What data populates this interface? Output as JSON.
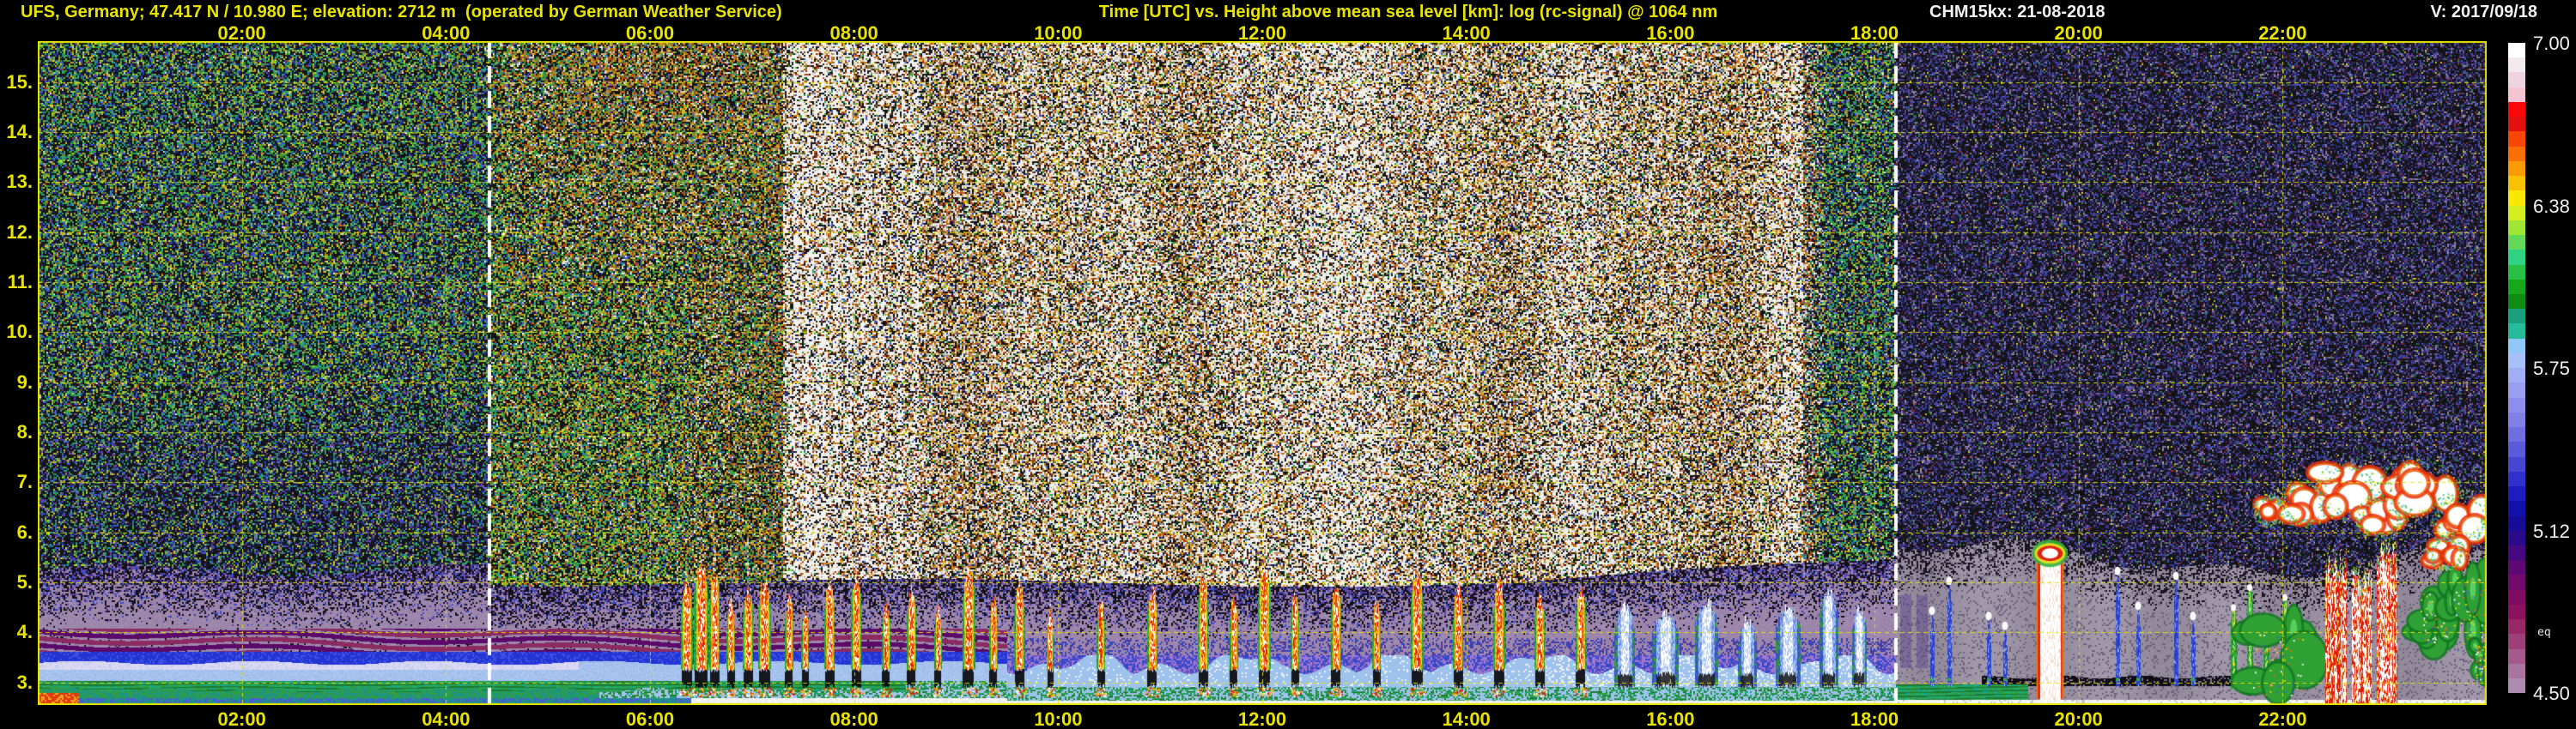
{
  "header": {
    "left": "UFS, Germany; 47.417 N / 10.980 E; elevation: 2712 m  (operated by German Weather Service)",
    "center": "Time [UTC] vs. Height above mean sea level [km]: log (rc-signal) @ 1064 nm",
    "device_date": "CHM15kx: 21-08-2018",
    "version": "V: 2017/09/18"
  },
  "colors": {
    "background": "#000000",
    "axis_yellow": "#e8e400",
    "grid_yellow": "#e6e600",
    "text_white": "#f2f2f2",
    "sun_line": "#ffffff"
  },
  "axes": {
    "x_ticks": [
      "02:00",
      "04:00",
      "06:00",
      "08:00",
      "10:00",
      "12:00",
      "14:00",
      "16:00",
      "18:00",
      "20:00",
      "22:00"
    ],
    "y_ticks": [
      "15.",
      "14.",
      "13.",
      "12.",
      "11.",
      "10.",
      "9.",
      "8.",
      "7.",
      "6.",
      "5.",
      "4.",
      "3."
    ]
  },
  "colorbar": {
    "note": "eq",
    "labels": [
      {
        "text": "7.00",
        "v": 7.0
      },
      {
        "text": "6.38",
        "v": 6.375
      },
      {
        "text": "5.75",
        "v": 5.75
      },
      {
        "text": "5.12",
        "v": 5.125
      },
      {
        "text": "4.50",
        "v": 4.5
      }
    ],
    "palette": [
      "#ffffff",
      "#f2e8ee",
      "#eed4e0",
      "#f4c4d2",
      "#fa0808",
      "#e41010",
      "#fa4604",
      "#fa7004",
      "#fa9a04",
      "#fac204",
      "#fae804",
      "#d2ee1e",
      "#a0e634",
      "#62da58",
      "#30d284",
      "#28c045",
      "#16a81a",
      "#0f8c12",
      "#1ba07e",
      "#24bc9a",
      "#90c8f8",
      "#a8c0f8",
      "#a2aef4",
      "#9a9ef0",
      "#8e8eec",
      "#8080e6",
      "#6e6ee0",
      "#5a5ada",
      "#4646d2",
      "#3030cc",
      "#1c1cc0",
      "#1212aa",
      "#170c98",
      "#2c0a8c",
      "#460880",
      "#5e0876",
      "#720a6e",
      "#800c62",
      "#8c1260",
      "#962866",
      "#9e4078",
      "#a45a8c",
      "#aa74a0",
      "#ae8cb2"
    ]
  },
  "chart_data": {
    "type": "heatmap",
    "title": "Time [UTC] vs. Height above mean sea level [km]: log (rc-signal) @ 1064 nm",
    "station": "UFS, Germany; 47.417 N / 10.980 E; elevation: 2712 m",
    "instrument": "CHM15kx",
    "date": "21-08-2018",
    "x_hours_range": [
      0,
      24
    ],
    "y_km_range": [
      2.55,
      15.82
    ],
    "signal_range": [
      4.5,
      7.0
    ],
    "sun_lines_hours": [
      4.43,
      18.21
    ],
    "grid": {
      "x_step_hours": 2,
      "y_step_km": 1
    },
    "noise": {
      "night1_hi": {
        "black": 0.4,
        "colors": [
          [
            "#2fa23e",
            0.2
          ],
          [
            "#96c92e",
            0.13
          ],
          [
            "#c9c326",
            0.12
          ],
          [
            "#27a289",
            0.16
          ],
          [
            "#4157d6",
            0.17
          ],
          [
            "#232e8e",
            0.12
          ],
          [
            "#b8831e",
            0.05
          ],
          [
            "#b03a20",
            0.03
          ],
          [
            "#d8d8d8",
            0.02
          ]
        ]
      },
      "night1_lo": {
        "black": 0.5,
        "colors": [
          [
            "#3c50cc",
            0.22
          ],
          [
            "#232a80",
            0.16
          ],
          [
            "#279a86",
            0.14
          ],
          [
            "#2f9e40",
            0.14
          ],
          [
            "#6a3a9a",
            0.1
          ],
          [
            "#96c92e",
            0.08
          ],
          [
            "#c9c326",
            0.08
          ],
          [
            "#8a7a9e",
            0.08
          ]
        ]
      },
      "dawn": {
        "black": 0.36,
        "colors": [
          [
            "#2fa23e",
            0.22
          ],
          [
            "#96c92e",
            0.16
          ],
          [
            "#c9c326",
            0.16
          ],
          [
            "#c87a1e",
            0.12
          ],
          [
            "#27a289",
            0.12
          ],
          [
            "#4157d6",
            0.1
          ],
          [
            "#c04818",
            0.06
          ],
          [
            "#e8e4de",
            0.06
          ]
        ]
      },
      "day_orange": {
        "black": 0.33,
        "colors": [
          [
            "#c87a22",
            0.26
          ],
          [
            "#9a5a16",
            0.1
          ],
          [
            "#d8b81e",
            0.12
          ],
          [
            "#2fa23e",
            0.1
          ],
          [
            "#c03c16",
            0.08
          ],
          [
            "#e8e4de",
            0.14
          ],
          [
            "#4157d6",
            0.06
          ],
          [
            "#8a8a8a",
            0.06
          ],
          [
            "#27a289",
            0.04
          ],
          [
            "#96c92e",
            0.04
          ]
        ]
      },
      "day_bright": {
        "black": 0.27,
        "colors": [
          [
            "#f2efe8",
            0.3
          ],
          [
            "#cc7e20",
            0.22
          ],
          [
            "#b43c16",
            0.08
          ],
          [
            "#b8b2aa",
            0.1
          ],
          [
            "#d8c020",
            0.08
          ],
          [
            "#2fa23e",
            0.05
          ],
          [
            "#4157d6",
            0.05
          ],
          [
            "#9a5a16",
            0.06
          ],
          [
            "#e8e4de",
            0.06
          ]
        ]
      },
      "dusk": {
        "black": 0.4,
        "colors": [
          [
            "#2fa23e",
            0.22
          ],
          [
            "#27a289",
            0.16
          ],
          [
            "#96c92e",
            0.1
          ],
          [
            "#c9c326",
            0.1
          ],
          [
            "#4157d6",
            0.12
          ],
          [
            "#c87a1e",
            0.08
          ],
          [
            "#8a7a9e",
            0.06
          ],
          [
            "#e8e4de",
            0.04
          ],
          [
            "#232e8e",
            0.12
          ]
        ]
      },
      "night2": {
        "black": 0.52,
        "colors": [
          [
            "#3a3a92",
            0.22
          ],
          [
            "#5c4a9e",
            0.16
          ],
          [
            "#26285e",
            0.18
          ],
          [
            "#3c50b4",
            0.12
          ],
          [
            "#8a7aa0",
            0.14
          ],
          [
            "#44206a",
            0.1
          ],
          [
            "#2f7a3a",
            0.04
          ],
          [
            "#8a2a2a",
            0.02
          ],
          [
            "#c9c326",
            0.02
          ]
        ]
      }
    },
    "features": {
      "bright_stripes": [
        7.42,
        7.55,
        7.67,
        7.82,
        7.95,
        8.1,
        8.27,
        8.45,
        8.6
      ],
      "day_spikes": [
        [
          6.36,
          5.0,
          0.055
        ],
        [
          6.5,
          5.35,
          0.07
        ],
        [
          6.63,
          5.2,
          0.05
        ],
        [
          6.79,
          4.65,
          0.04
        ],
        [
          6.96,
          4.85,
          0.05
        ],
        [
          7.12,
          5.05,
          0.06
        ],
        [
          7.36,
          4.7,
          0.04
        ],
        [
          7.52,
          4.45,
          0.035
        ],
        [
          7.76,
          4.95,
          0.05
        ],
        [
          8.02,
          5.15,
          0.05
        ],
        [
          8.31,
          4.6,
          0.04
        ],
        [
          8.56,
          4.85,
          0.045
        ],
        [
          8.82,
          4.5,
          0.035
        ],
        [
          9.12,
          5.25,
          0.06
        ],
        [
          9.36,
          4.7,
          0.04
        ],
        [
          9.62,
          5.0,
          0.05
        ],
        [
          9.92,
          4.45,
          0.03
        ],
        [
          10.42,
          4.6,
          0.04
        ],
        [
          10.92,
          4.85,
          0.05
        ],
        [
          11.42,
          5.1,
          0.05
        ],
        [
          11.72,
          4.7,
          0.04
        ],
        [
          12.02,
          5.3,
          0.06
        ],
        [
          12.32,
          4.8,
          0.04
        ],
        [
          12.72,
          5.0,
          0.05
        ],
        [
          13.12,
          4.65,
          0.04
        ],
        [
          13.52,
          5.2,
          0.06
        ],
        [
          13.92,
          4.9,
          0.05
        ],
        [
          14.32,
          5.0,
          0.055
        ],
        [
          14.72,
          4.75,
          0.05
        ],
        [
          15.12,
          4.9,
          0.05
        ]
      ],
      "blue_plumes": [
        [
          15.55,
          4.5,
          0.1
        ],
        [
          15.95,
          4.35,
          0.13
        ],
        [
          16.35,
          4.6,
          0.11
        ],
        [
          16.75,
          4.25,
          0.09
        ],
        [
          17.15,
          4.5,
          0.12
        ],
        [
          17.55,
          4.8,
          0.09
        ],
        [
          17.85,
          4.45,
          0.07
        ]
      ],
      "evening_columns": [
        [
          18.56,
          4.5
        ],
        [
          18.73,
          5.1
        ],
        [
          19.12,
          4.4
        ],
        [
          19.28,
          4.2
        ],
        [
          20.38,
          5.3
        ],
        [
          20.58,
          4.6
        ],
        [
          20.95,
          5.2
        ],
        [
          21.12,
          4.4
        ]
      ],
      "white_plume": {
        "t": 19.72,
        "top": 5.65,
        "w": 0.1
      },
      "green_plumes": [
        [
          21.52,
          4.55
        ],
        [
          21.68,
          4.95
        ],
        [
          21.84,
          4.35
        ],
        [
          22.02,
          4.75
        ],
        [
          22.14,
          4.4
        ]
      ],
      "clouds": [
        [
          21.86,
          6.45,
          0.14,
          0.3
        ],
        [
          22.2,
          6.6,
          0.3,
          0.55
        ],
        [
          22.62,
          6.85,
          0.38,
          0.7
        ],
        [
          22.95,
          6.3,
          0.28,
          0.5
        ],
        [
          23.35,
          6.9,
          0.55,
          0.75
        ],
        [
          23.75,
          6.35,
          0.35,
          0.6
        ],
        [
          23.6,
          5.6,
          0.2,
          0.35
        ]
      ],
      "red_towers": [
        [
          22.42,
          22.62,
          5.3
        ],
        [
          22.68,
          22.86,
          5.0
        ],
        [
          22.92,
          23.12,
          5.55
        ]
      ],
      "green_clouds": [
        [
          21.95,
          3.4,
          0.5,
          1.3
        ],
        [
          23.5,
          4.3,
          0.3,
          1.0
        ],
        [
          23.82,
          4.4,
          0.3,
          1.5
        ],
        [
          23.95,
          3.4,
          0.12,
          0.7
        ]
      ],
      "purple_columns": [
        18.3,
        18.46
      ]
    }
  }
}
